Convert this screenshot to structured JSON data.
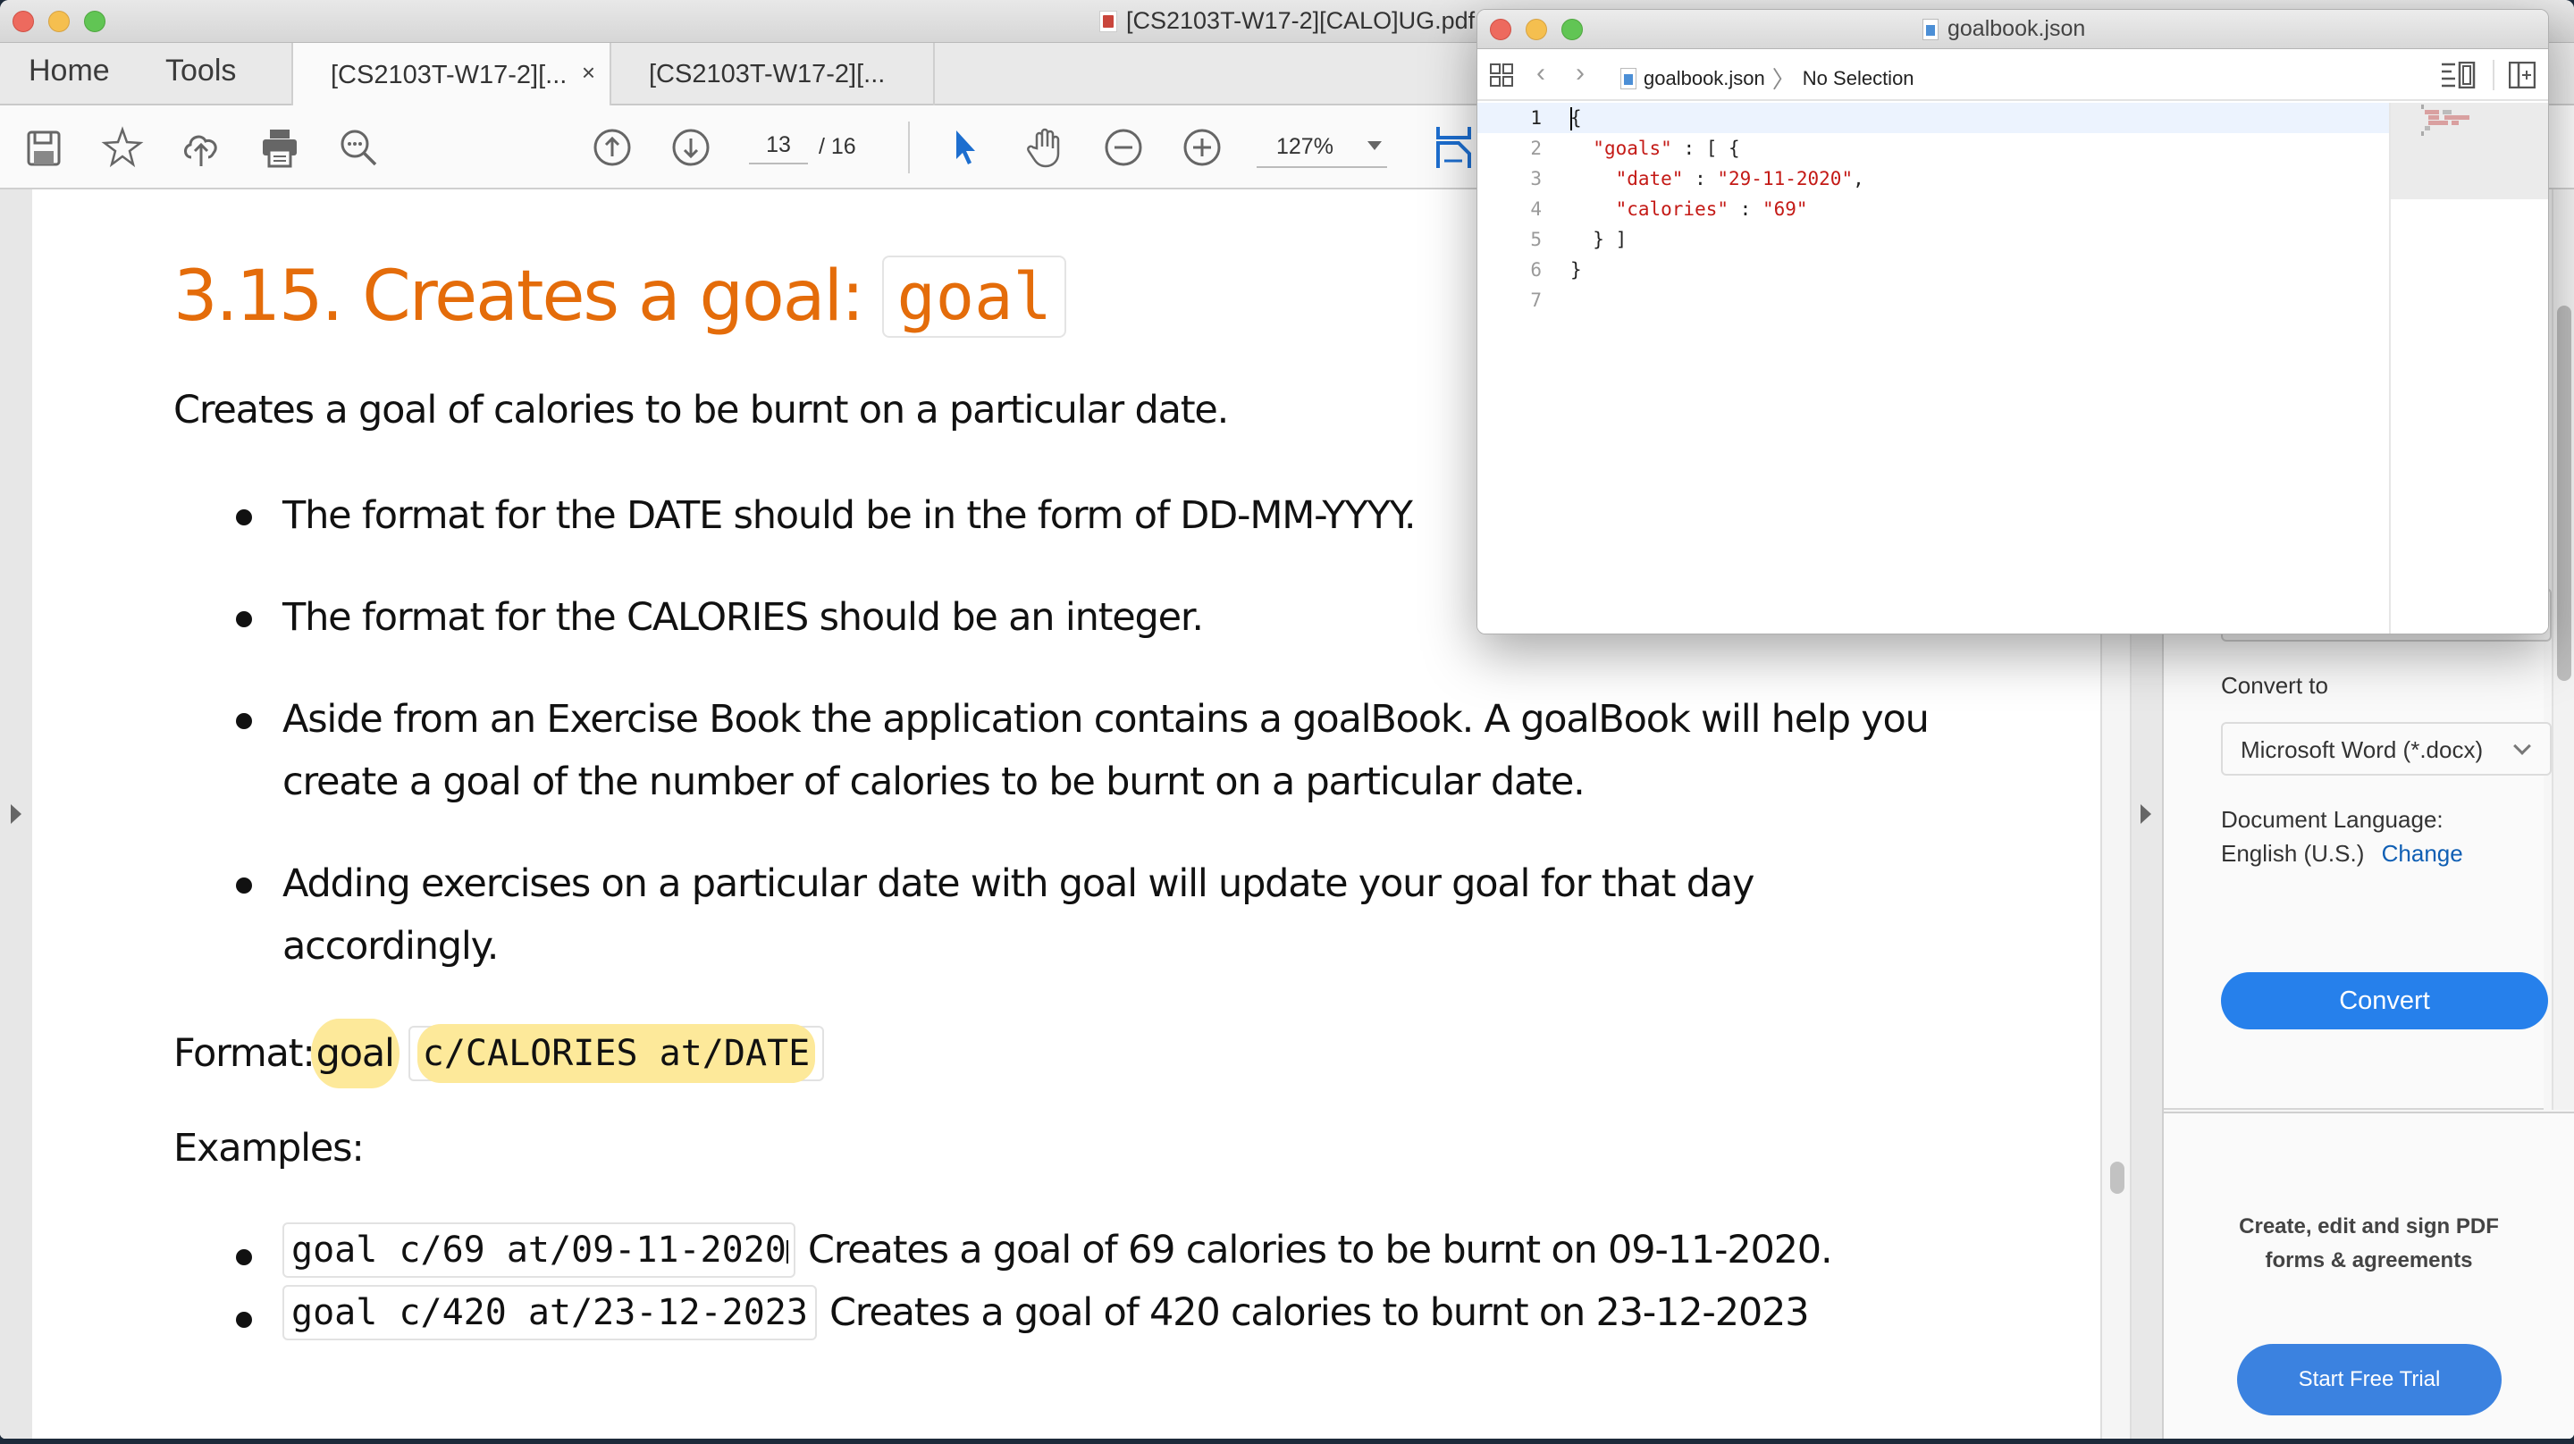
{
  "acrobat": {
    "window_title": "[CS2103T-W17-2][CALO]UG.pdf",
    "nav_tabs": [
      {
        "label": "Home"
      },
      {
        "label": "Tools"
      }
    ],
    "doc_tabs": [
      {
        "label": "[CS2103T-W17-2][...",
        "active": true,
        "close_label": "×"
      },
      {
        "label": "[CS2103T-W17-2][...",
        "active": false
      }
    ],
    "toolbar": {
      "current_page": "13",
      "total_pages": "/ 16",
      "zoom_level": "127%",
      "icons": [
        "save-icon",
        "bookmark-star-icon",
        "upload-cloud-icon",
        "print-icon",
        "search-icon",
        "page-up-icon",
        "page-down-icon",
        "select-pointer-icon",
        "hand-tool-icon",
        "zoom-out-icon",
        "zoom-in-icon",
        "fit-width-icon"
      ]
    },
    "document": {
      "heading_text": "3.15. Creates a goal:",
      "heading_code": "goal",
      "intro": "Creates a goal of calories to be burnt on a particular date.",
      "bullets": [
        {
          "lines": [
            "The format for the DATE should be in the form of DD-MM-YYYY."
          ]
        },
        {
          "lines": [
            "The format for the CALORIES should be an integer."
          ]
        },
        {
          "lines": [
            "Aside from an Exercise Book the application contains a goalBook. A goalBook will help you",
            "create a goal of the number of calories to be burnt on a particular date."
          ]
        },
        {
          "lines": [
            "Adding exercises on a particular date with goal will update your goal for that day",
            "accordingly."
          ]
        }
      ],
      "format_label": "Format:",
      "format_command": "goal",
      "format_args": "c/CALORIES at/DATE",
      "examples_label": "Examples:",
      "examples": [
        {
          "code": "goal c/69 at/09-11-2020",
          "description": "Creates a goal of 69 calories to be burnt on 09-11-2020."
        },
        {
          "code": "goal c/420 at/23-12-2023",
          "description": "Creates a goal of 420 calories to burnt on 23-12-2023"
        }
      ]
    },
    "right_panel": {
      "convert_to_label": "Convert to",
      "convert_to_value": "Microsoft Word (*.docx)",
      "doc_language_label": "Document Language:",
      "doc_language_value": "English (U.S.)",
      "change_link": "Change",
      "convert_button": "Convert",
      "promo_line1": "Create, edit and sign PDF",
      "promo_line2": "forms & agreements",
      "trial_button": "Start Free Trial"
    }
  },
  "editor": {
    "window_title": "goalbook.json",
    "breadcrumb": {
      "file": "goalbook.json",
      "separator": "〉",
      "selection": "No Selection"
    },
    "code_lines": [
      {
        "n": "1",
        "parts": [
          {
            "t": "{",
            "s": false
          }
        ]
      },
      {
        "n": "2",
        "parts": [
          {
            "t": "  ",
            "s": false
          },
          {
            "t": "\"goals\"",
            "s": true
          },
          {
            "t": " : [ {",
            "s": false
          }
        ]
      },
      {
        "n": "3",
        "parts": [
          {
            "t": "    ",
            "s": false
          },
          {
            "t": "\"date\"",
            "s": true
          },
          {
            "t": " : ",
            "s": false
          },
          {
            "t": "\"29-11-2020\"",
            "s": true
          },
          {
            "t": ",",
            "s": false
          }
        ]
      },
      {
        "n": "4",
        "parts": [
          {
            "t": "    ",
            "s": false
          },
          {
            "t": "\"calories\"",
            "s": true
          },
          {
            "t": " : ",
            "s": false
          },
          {
            "t": "\"69\"",
            "s": true
          }
        ]
      },
      {
        "n": "5",
        "parts": [
          {
            "t": "  } ]",
            "s": false
          }
        ]
      },
      {
        "n": "6",
        "parts": [
          {
            "t": "}",
            "s": false
          }
        ]
      },
      {
        "n": "7",
        "parts": []
      }
    ],
    "current_line": 1
  },
  "colors": {
    "heading_orange": "#e46c0a",
    "highlight_yellow": "#fde99a",
    "acrobat_blue": "#2680eb",
    "json_string_red": "#c41a16",
    "link_blue": "#0f5fb4"
  }
}
